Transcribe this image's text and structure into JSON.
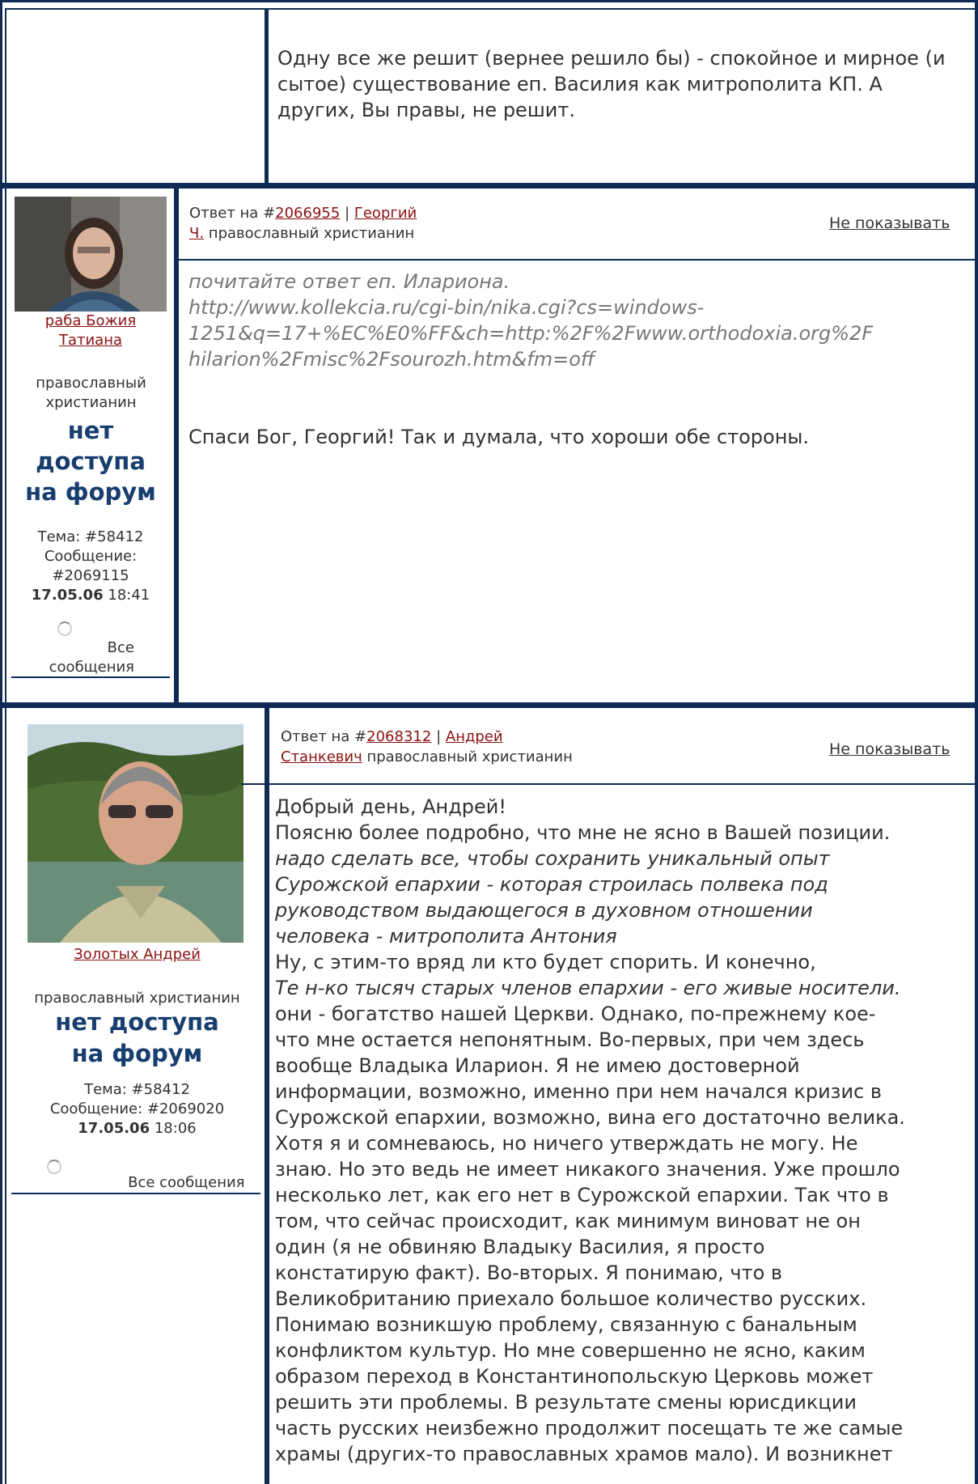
{
  "post1": {
    "body": "Одну все же решит (вернее решило бы) - спокойное и мирное (и сытое) существование еп. Василия как митрополита КП. А других, Вы правы, не решит."
  },
  "post2": {
    "author_name_line1": "раба Божия",
    "author_name_line2": "Татиана",
    "role": "православный христианин",
    "access_line1": "нет",
    "access_line2": "доступа",
    "access_line3": "на форум",
    "topic_label": "Тема: #58412",
    "message_label": "Сообщение:",
    "message_id": "#2069115",
    "date": "17.05.06",
    "time": "18:41",
    "all_messages": "Все сообщения",
    "reply_prefix": "Ответ на #",
    "reply_id": "2066955",
    "reply_sep": "|",
    "reply_author_1": "Георгий",
    "reply_author_2": "Ч.",
    "reply_role": "православный христианин",
    "hide_label": "Не показывать",
    "quote_1": "почитайте ответ еп. Илариона.",
    "quote_2": "http://www.kollekcia.ru/cgi-bin/nika.cgi?cs=windows-",
    "quote_3": "1251&q=17+%EC%E0%FF&ch=http:%2F%2Fwww.orthodoxia.org%2F",
    "quote_4": "hilarion%2Fmisc%2Fsourozh.htm&fm=off",
    "text": "Спаси Бог, Георгий! Так и думала, что хороши обе стороны."
  },
  "post3": {
    "author_name": "Золотых Андрей",
    "role": "православный христианин",
    "access_line1": "нет доступа",
    "access_line2": "на форум",
    "topic_label": "Тема: #58412",
    "message_label": "Сообщение: #2069020",
    "date": "17.05.06",
    "time": "18:06",
    "all_messages": "Все сообщения",
    "reply_prefix": "Ответ на #",
    "reply_id": "2068312",
    "reply_sep": "|",
    "reply_author_1": "Андрей",
    "reply_author_2": "Станкевич",
    "reply_role": "православный христианин",
    "hide_label": "Не показывать",
    "lines": [
      "Добрый день, Андрей!",
      "Поясню более подробно, что мне не ясно в Вашей позиции."
    ],
    "quote_a": [
      "надо сделать все, чтобы сохранить уникальный опыт",
      "Сурожской епархии - которая строилась полвека под",
      "руководством выдающегося в духовном отношении",
      "человека - митрополита Антония"
    ],
    "line_b": "Ну, с этим-то вряд ли кто будет спорить. И конечно,",
    "quote_b": "Те н-ко тысяч старых членов епархии - его живые носители.",
    "rest": [
      "они - богатство нашей Церкви. Однако, по-прежнему кое-",
      "что мне остается непонятным. Во-первых, при чем здесь",
      "вообще Владыка Иларион. Я не имею достоверной",
      "информации, возможно, именно при нем начался кризис в",
      "Сурожской епархии, возможно, вина его достаточно велика.",
      "Хотя я и сомневаюсь, но ничего утверждать не могу. Не",
      "знаю. Но это ведь не имеет никакого значения. Уже прошло",
      "несколько лет, как его нет в Сурожской епархии. Так что в",
      "том, что сейчас происходит, как минимум виноват не он",
      "один (я не обвиняю Владыку Василия, я просто",
      "констатирую факт). Во-вторых. Я понимаю, что в",
      "Великобританию приехало большое количество русских.",
      "Понимаю возникшую проблему, связанную с банальным",
      "конфликтом культур. Но мне совершенно не ясно, каким",
      "образом переход в Константинопольскую Церковь может",
      "решить эти проблемы. В результате смены юрисдикции",
      "часть русских неизбежно продолжит посещать те же самые",
      "храмы (других-то православных храмов мало). И возникнет"
    ]
  }
}
